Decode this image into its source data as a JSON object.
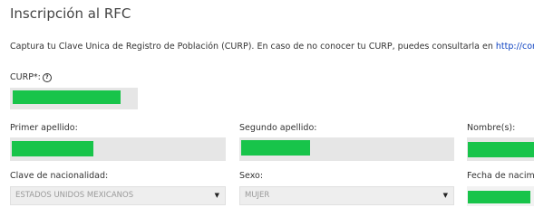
{
  "page": {
    "title": "Inscripción al RFC",
    "instructions": "Captura tu Clave Única de Registro de Población (CURP). En caso de no conocer tu CURP, puedes consultarla en ",
    "instructions_link": "http://consu"
  },
  "form": {
    "curp_label": "CURP*:",
    "help_icon_glyph": "?",
    "primer_apellido_label": "Primer apellido:",
    "segundo_apellido_label": "Segundo apellido:",
    "nombres_label": "Nombre(s):",
    "nacionalidad_label": "Clave de nacionalidad:",
    "nacionalidad_value": "ESTADOS UNIDOS MEXICANOS",
    "sexo_label": "Sexo:",
    "sexo_value": "MUJER",
    "fecha_label": "Fecha de nacimi",
    "dropdown_glyph": "▼"
  },
  "colors": {
    "redaction": "#18c44a",
    "field_bg": "#e6e6e6",
    "link": "#0b40c0"
  }
}
